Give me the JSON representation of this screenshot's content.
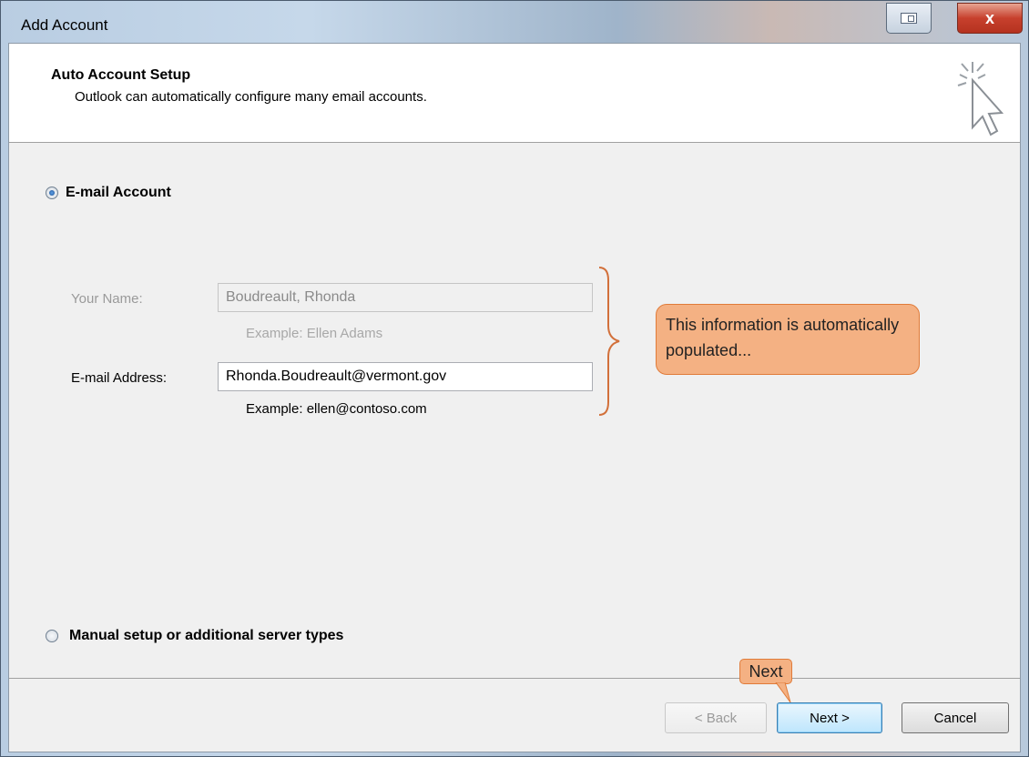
{
  "window": {
    "title": "Add Account",
    "close_label": "x"
  },
  "header": {
    "title": "Auto Account Setup",
    "subtitle": "Outlook can automatically configure many email accounts."
  },
  "options": {
    "email_account": {
      "label": "E-mail Account",
      "selected": true
    },
    "manual_setup": {
      "label": "Manual setup or additional server types",
      "selected": false
    }
  },
  "form": {
    "name_label": "Your Name:",
    "name_value": "Boudreault, Rhonda",
    "name_example": "Example: Ellen Adams",
    "email_label": "E-mail Address:",
    "email_value": "Rhonda.Boudreault@vermont.gov",
    "email_example": "Example: ellen@contoso.com"
  },
  "annotations": {
    "populated_callout": "This information is automatically populated...",
    "next_callout": "Next",
    "accent": "#f4b183"
  },
  "buttons": {
    "back": "< Back",
    "next": "Next >",
    "cancel": "Cancel"
  }
}
